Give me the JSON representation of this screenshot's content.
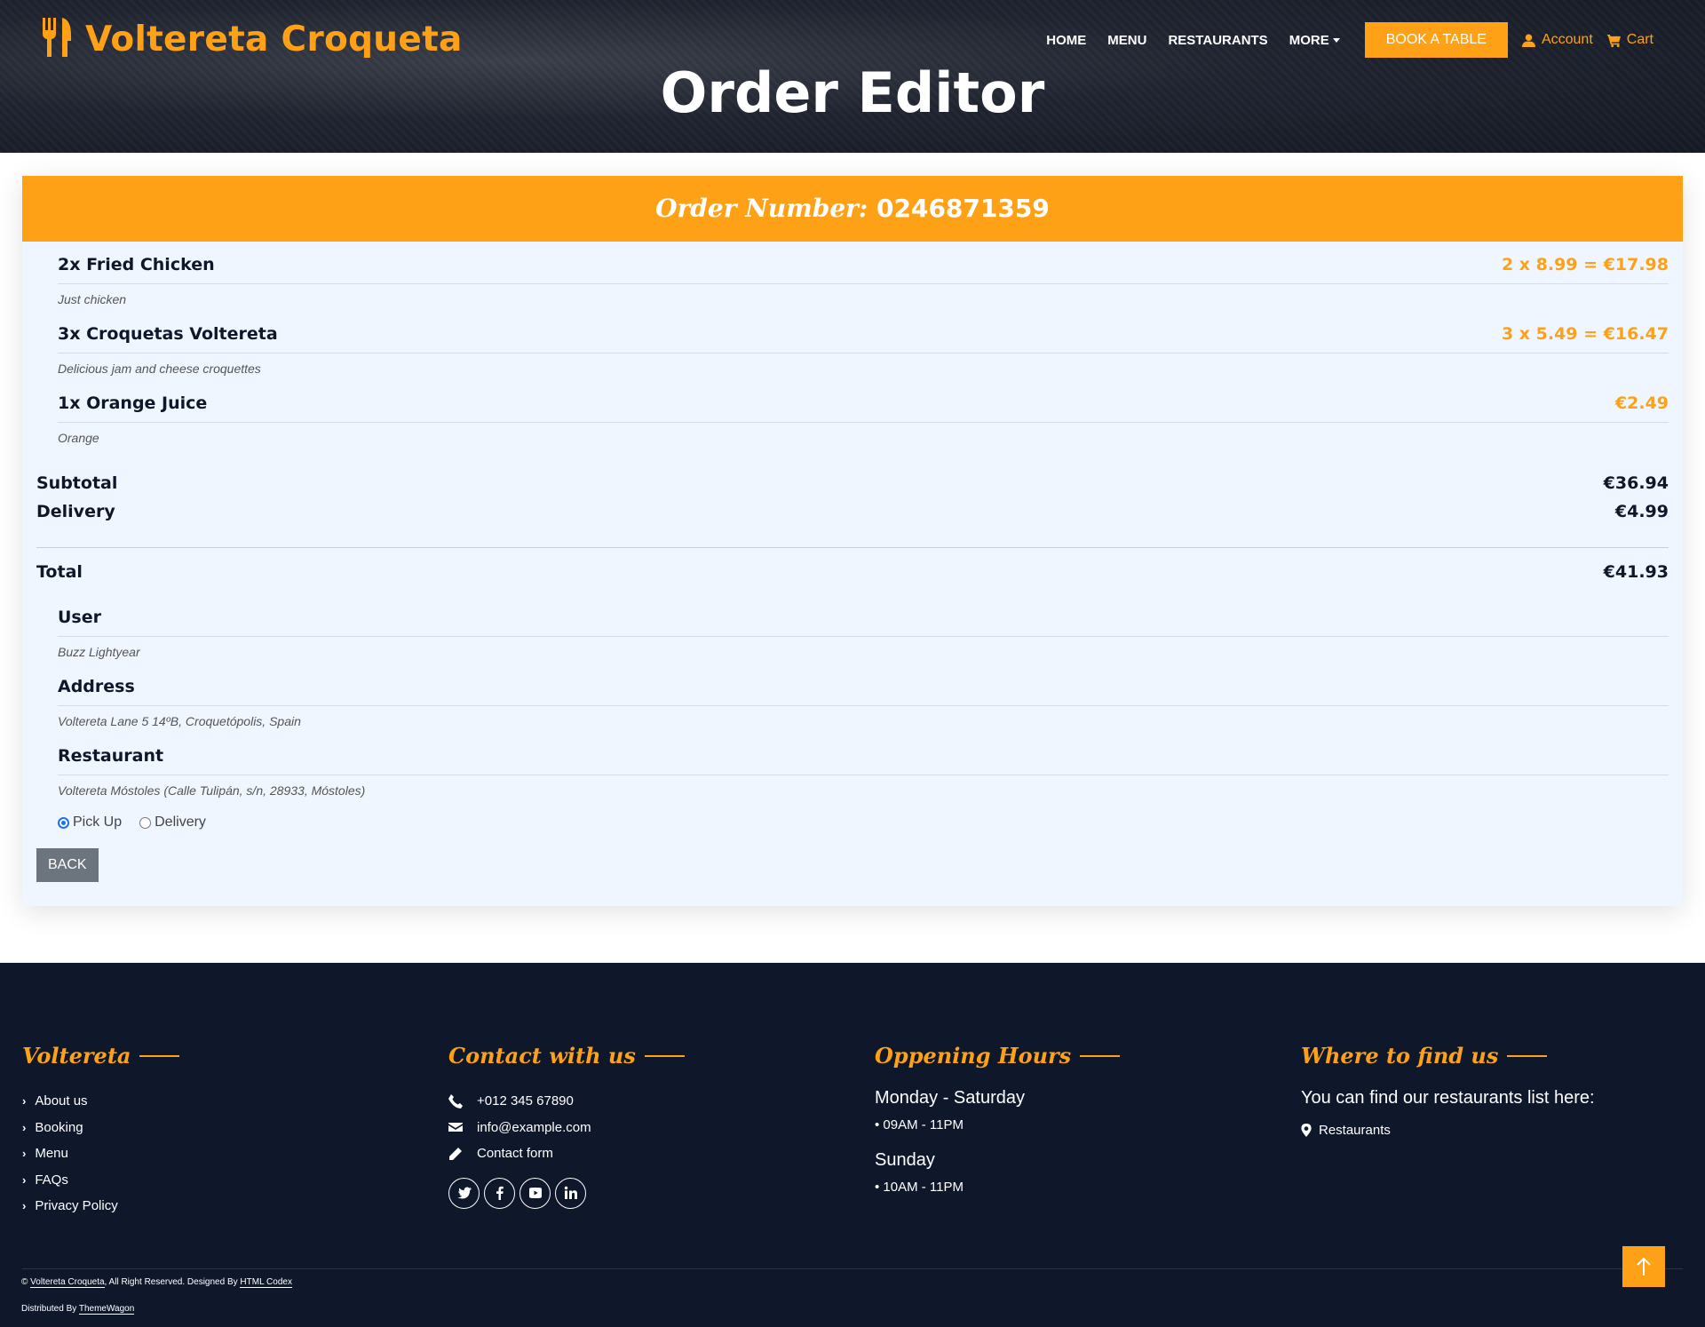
{
  "brand": {
    "name": "Voltereta Croqueta"
  },
  "nav": {
    "items": [
      "HOME",
      "MENU",
      "RESTAURANTS",
      "MORE"
    ],
    "book_label": "BOOK A TABLE",
    "account_label": "Account",
    "cart_label": "Cart"
  },
  "page": {
    "title": "Order Editor"
  },
  "order": {
    "number_label": "Order Number:",
    "number": "0246871359",
    "items": [
      {
        "name": "2x Fried Chicken",
        "price": "2 x 8.99 = €17.98",
        "description": "Just chicken"
      },
      {
        "name": "3x Croquetas Voltereta",
        "price": "3 x 5.49 = €16.47",
        "description": "Delicious jam and cheese croquettes"
      },
      {
        "name": "1x Orange Juice",
        "price": "€2.49",
        "description": "Orange"
      }
    ],
    "subtotal_label": "Subtotal",
    "subtotal": "€36.94",
    "delivery_label": "Delivery",
    "delivery": "€4.99",
    "total_label": "Total",
    "total": "€41.93",
    "info": [
      {
        "label": "User",
        "value": "Buzz Lightyear"
      },
      {
        "label": "Address",
        "value": "Voltereta Lane 5 14ºB, Croquetópolis, Spain"
      },
      {
        "label": "Restaurant",
        "value": "Voltereta Móstoles (Calle Tulipán, s/n, 28933, Móstoles)"
      }
    ],
    "method_options": [
      "Pick Up",
      "Delivery"
    ],
    "method_selected": "Pick Up",
    "back_label": "BACK"
  },
  "footer": {
    "col1": {
      "title": "Voltereta",
      "links": [
        "About us",
        "Booking",
        "Menu",
        "FAQs",
        "Privacy Policy"
      ]
    },
    "col2": {
      "title": "Contact with us",
      "phone": "+012 345 67890",
      "email": "info@example.com",
      "form": "Contact form"
    },
    "col3": {
      "title": "Oppening Hours",
      "day1": "Monday - Saturday",
      "time1": "• 09AM - 11PM",
      "day2": "Sunday",
      "time2": "• 10AM - 11PM"
    },
    "col4": {
      "title": "Where to find us",
      "text": "You can find our restaurants list here:",
      "link": "Restaurants"
    },
    "copyright_prefix": "©",
    "copyright_site": "Voltereta Croqueta",
    "copyright_mid": ", All Right Reserved. Designed By",
    "designer": "HTML Codex",
    "distributed_prefix": "Distributed By",
    "distributor": "ThemeWagon"
  },
  "colors": {
    "primary": "#fea116",
    "dark": "#0f172b",
    "card_bg": "#f0f6ff",
    "back_button": "#6c757d"
  },
  "icons": [
    "utensils-icon",
    "user-icon",
    "cart-icon",
    "phone-icon",
    "envelope-icon",
    "pencil-icon",
    "twitter-icon",
    "facebook-icon",
    "youtube-icon",
    "linkedin-icon",
    "map-pin-icon",
    "arrow-up-icon"
  ]
}
